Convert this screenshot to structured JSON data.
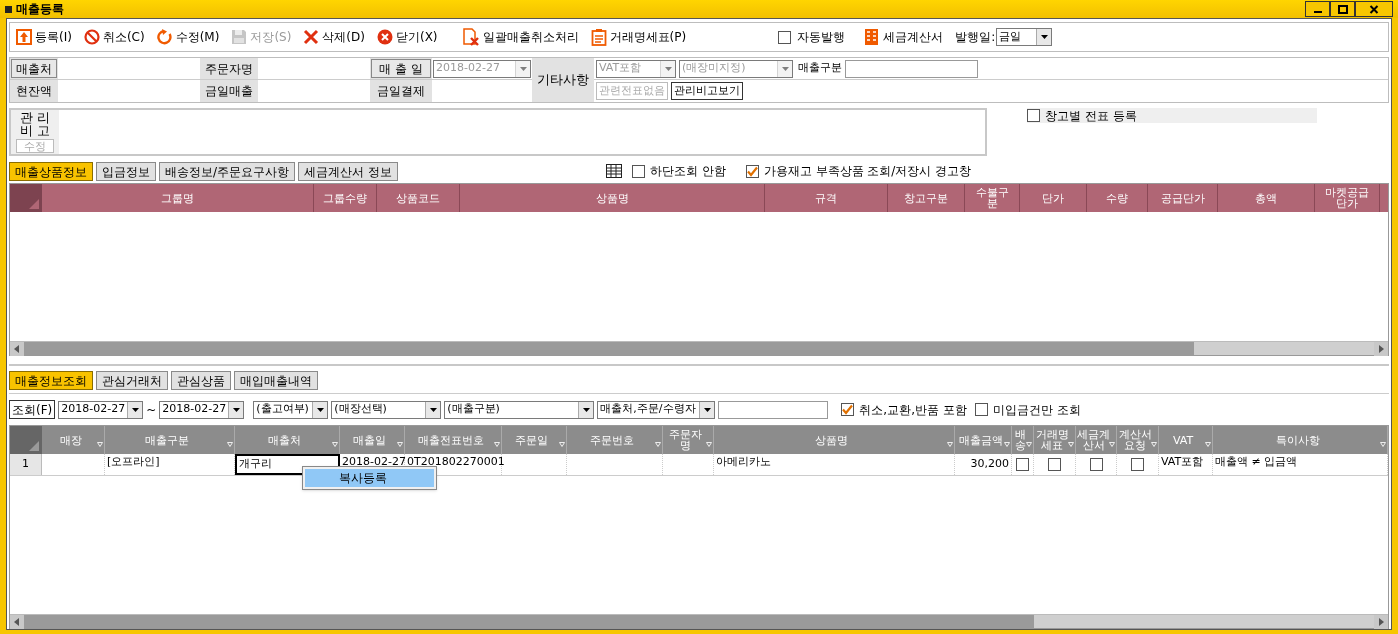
{
  "window": {
    "title": "매출등록"
  },
  "toolbar": {
    "buttons": [
      {
        "label": "등록(I)",
        "disabled": false
      },
      {
        "label": "취소(C)",
        "disabled": false
      },
      {
        "label": "수정(M)",
        "disabled": false
      },
      {
        "label": "저장(S)",
        "disabled": true
      },
      {
        "label": "삭제(D)",
        "disabled": false
      },
      {
        "label": "닫기(X)",
        "disabled": false
      },
      {
        "label": "일괄매출취소처리",
        "disabled": false
      },
      {
        "label": "거래명세표(P)",
        "disabled": false
      }
    ],
    "auto_issue": {
      "label": "자동발행",
      "checked": false
    },
    "tax_invoice": {
      "label": "세금계산서"
    },
    "issue_date": {
      "label": "발행일:",
      "value": "금일"
    }
  },
  "form": {
    "customer": "매출처",
    "orderer": "주문자명",
    "sale_date": {
      "label": "매 출 일",
      "value": "2018-02-27",
      "disabled": true
    },
    "balance": "현잔액",
    "today_sales": "금일매출",
    "today_payment": "금일결제",
    "notes": "기타사항",
    "vat": {
      "value": "VAT포함",
      "disabled": true
    },
    "store": {
      "value": "(매장미지정)",
      "disabled": true
    },
    "sales_type": "매출구분",
    "related_slip": {
      "label": "관련전표없음",
      "disabled": true
    },
    "view_memo": {
      "label": "관리비고보기",
      "disabled": false
    }
  },
  "memo": {
    "label": "관 리 비 고",
    "edit": {
      "label": "수정",
      "disabled": true
    }
  },
  "warehouse_slip": {
    "label": "창고별 전표 등록",
    "checked": false
  },
  "upper_tabs": [
    {
      "label": "매출상품정보",
      "selected": true
    },
    {
      "label": "입금정보",
      "selected": false
    },
    {
      "label": "배송정보/주문요구사항",
      "selected": false
    },
    {
      "label": "세금계산서 정보",
      "selected": false
    }
  ],
  "options": [
    {
      "label": "하단조회 안함",
      "checked": false
    },
    {
      "label": "가용재고 부족상품 조회/저장시 경고창",
      "checked": true
    }
  ],
  "product_grid": {
    "columns": [
      "그룹명",
      "그룹수량",
      "상품코드",
      "상품명",
      "규격",
      "창고구분",
      "수불구분",
      "단가",
      "수량",
      "공급단가",
      "총액",
      "마켓공급단가"
    ]
  },
  "lower_tabs": [
    {
      "label": "매출정보조회",
      "selected": true
    },
    {
      "label": "관심거래처",
      "selected": false
    },
    {
      "label": "관심상품",
      "selected": false
    },
    {
      "label": "매입매출내역",
      "selected": false
    }
  ],
  "filters": {
    "search_button": "조회(F)",
    "date_from": "2018-02-27",
    "separator": "~",
    "date_to": "2018-02-27",
    "selects": [
      "(출고여부)",
      "(매장선택)",
      "(매출구분)",
      "매출처,주문/수령자"
    ],
    "options": [
      {
        "label": "취소,교환,반품 포함",
        "checked": true
      },
      {
        "label": "미입금건만 조회",
        "checked": false
      }
    ]
  },
  "sales_grid": {
    "columns": [
      "매장",
      "매출구분",
      "매출처",
      "매출일",
      "매출전표번호",
      "주문일",
      "주문번호",
      "주문자명",
      "상품명",
      "매출금액",
      "배송",
      "거래명세표",
      "세금계산서",
      "계산서요청",
      "VAT",
      "특이사항"
    ],
    "rows": [
      {
        "number": "1",
        "cells": [
          {
            "kind": "text",
            "selected": false
          },
          {
            "kind": "text",
            "value": "[오프라인]",
            "selected": false
          },
          {
            "kind": "text",
            "value": "개구리",
            "selected": true
          },
          {
            "kind": "text",
            "value": "2018-02-27",
            "selected": false
          },
          {
            "kind": "text",
            "value": "0T201802270001",
            "selected": false
          },
          {
            "kind": "text",
            "selected": false
          },
          {
            "kind": "text",
            "selected": false
          },
          {
            "kind": "text",
            "selected": false
          },
          {
            "kind": "text",
            "value": "아메리카노",
            "selected": false
          },
          {
            "kind": "number",
            "value": "30,200",
            "selected": false
          },
          {
            "kind": "checkbox",
            "checked": false,
            "selected": false
          },
          {
            "kind": "checkbox",
            "checked": false,
            "selected": false
          },
          {
            "kind": "checkbox",
            "checked": false,
            "selected": false
          },
          {
            "kind": "checkbox",
            "checked": false,
            "selected": false
          },
          {
            "kind": "text",
            "value": "VAT포함",
            "selected": false
          },
          {
            "kind": "text",
            "value": "매출액 ≠ 입금액",
            "selected": false
          }
        ]
      }
    ]
  },
  "context_menu": {
    "items": [
      {
        "label": "복사등록",
        "selected": true
      }
    ]
  }
}
